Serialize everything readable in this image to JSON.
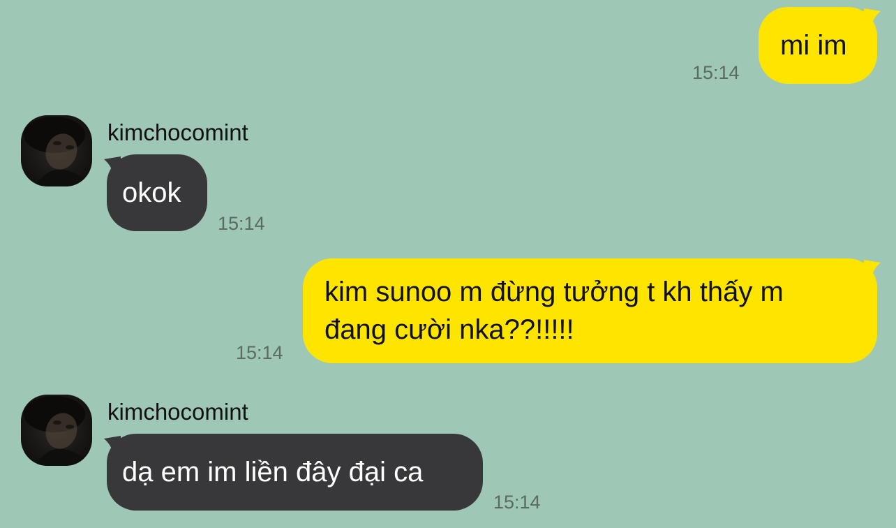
{
  "chat": {
    "colors": {
      "background": "#9ec7b5",
      "outgoing_bubble": "#fee500",
      "incoming_bubble": "#38383a",
      "timestamp_text": "#5a6b63"
    },
    "messages": [
      {
        "direction": "outgoing",
        "text": "mi im",
        "time": "15:14"
      },
      {
        "direction": "incoming",
        "sender": "kimchocomint",
        "avatar_icon": "profile-photo-avatar",
        "text": "okok",
        "time": "15:14"
      },
      {
        "direction": "outgoing",
        "lines": [
          "kim sunoo m đừng tưởng t kh thấy m",
          "đang cười nka??!!!!!"
        ],
        "time": "15:14"
      },
      {
        "direction": "incoming",
        "sender": "kimchocomint",
        "avatar_icon": "profile-photo-avatar",
        "text": "dạ em im liền đây đại ca",
        "time": "15:14"
      }
    ]
  }
}
